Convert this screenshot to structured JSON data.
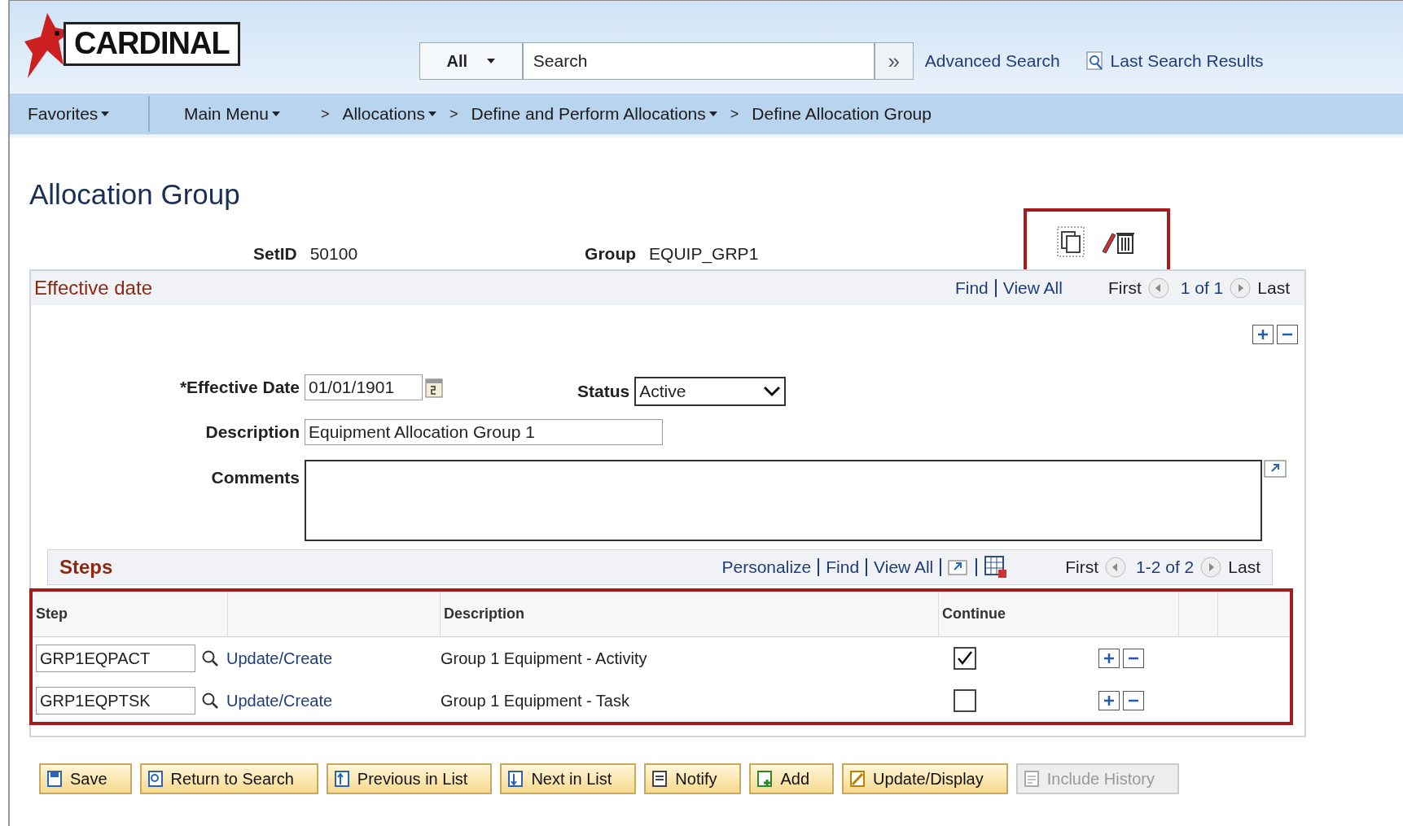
{
  "header": {
    "logo_text": "CARDINAL",
    "search_scope": "All",
    "search_placeholder": "Search",
    "search_go": "»",
    "links": [
      "Advanced Search",
      "Last Search Results"
    ]
  },
  "nav": {
    "items": [
      {
        "label": "Favorites",
        "dropdown": true
      },
      {
        "label": "Main Menu",
        "dropdown": true
      }
    ],
    "breadcrumbs": [
      {
        "label": "Allocations",
        "dropdown": true
      },
      {
        "label": "Define and Perform Allocations",
        "dropdown": true
      },
      {
        "label": "Define Allocation Group",
        "dropdown": false
      }
    ],
    "separator": ">"
  },
  "page": {
    "title": "Allocation Group",
    "keys": [
      {
        "label": "SetID",
        "value": "50100"
      },
      {
        "label": "Group",
        "value": "EQUIP_GRP1"
      }
    ]
  },
  "effective_panel": {
    "title": "Effective date",
    "links": [
      "Find",
      "View All"
    ],
    "first": "First",
    "count": "1 of 1",
    "last": "Last",
    "fields": {
      "effective_date": {
        "label": "*Effective Date",
        "value": "01/01/1901"
      },
      "status": {
        "label": "Status",
        "value": "Active"
      },
      "description": {
        "label": "Description",
        "value": "Equipment Allocation Group 1"
      },
      "comments": {
        "label": "Comments"
      }
    }
  },
  "steps": {
    "title": "Steps",
    "links": [
      "Personalize",
      "Find",
      "View All"
    ],
    "first": "First",
    "count": "1-2 of 2",
    "last": "Last",
    "columns": [
      "Step",
      "Description",
      "Continue"
    ],
    "rows": [
      {
        "step": "GRP1EQPACT",
        "link": "Update/Create",
        "description": "Group 1 Equipment - Activity",
        "checked": true
      },
      {
        "step": "GRP1EQPTSK",
        "link": "Update/Create",
        "description": "Group 1 Equipment - Task",
        "checked": false
      }
    ]
  },
  "buttons": [
    {
      "label": "Save",
      "kind": "save",
      "disabled": false
    },
    {
      "label": "Return to Search",
      "kind": "search",
      "disabled": false
    },
    {
      "label": "Previous in List",
      "kind": "prev",
      "disabled": false
    },
    {
      "label": "Next in List",
      "kind": "next",
      "disabled": false
    },
    {
      "label": "Notify",
      "kind": "notify",
      "disabled": false
    },
    {
      "label": "Add",
      "kind": "add",
      "disabled": false
    },
    {
      "label": "Update/Display",
      "kind": "update",
      "disabled": false
    },
    {
      "label": "Include History",
      "kind": "history",
      "disabled": true
    }
  ]
}
